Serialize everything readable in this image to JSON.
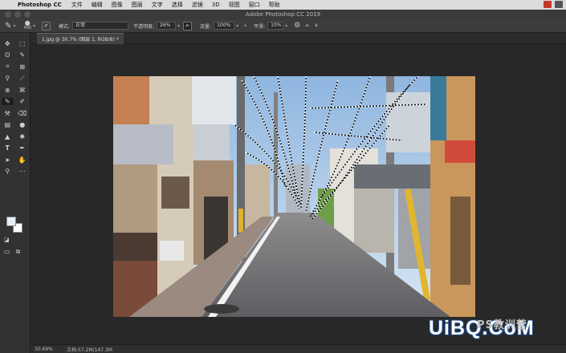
{
  "menubar": {
    "app_name": "Photoshop CC",
    "items": [
      "文件",
      "编辑",
      "图像",
      "图层",
      "文字",
      "选择",
      "滤镜",
      "3D",
      "视图",
      "窗口",
      "帮助"
    ]
  },
  "window": {
    "title": "Adobe Photoshop CC 2019"
  },
  "options": {
    "brush_size": "400",
    "mode_label": "模式:",
    "mode_value": "正常",
    "opacity_label": "不透明度:",
    "opacity_value": "26%",
    "flow_label": "流量:",
    "flow_value": "100%",
    "smooth_label": "平滑:",
    "smooth_value": "10%"
  },
  "document": {
    "tab_label": "1.jpg @ 30.7% (图层 1, RGB/8) *"
  },
  "status": {
    "zoom": "30.69%",
    "doc_info": "文档:57.2M/147.3M"
  },
  "watermark": {
    "text": "UiBQ.CoM",
    "sub": "PS教训营"
  },
  "colors": {
    "foreground": "#e8eef2",
    "background": "#ffffff",
    "accent": "#1473e6"
  }
}
